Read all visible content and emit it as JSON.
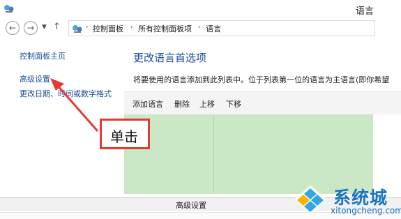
{
  "window": {
    "title": "语言"
  },
  "addressbar": {
    "breadcrumbs": [
      "控制面板",
      "所有控制面板项",
      "语言"
    ]
  },
  "sidebar": {
    "items": [
      {
        "label": "控制面板主页"
      },
      {
        "label": "高级设置"
      },
      {
        "label": "更改日期、时间或数字格式"
      }
    ]
  },
  "main": {
    "title": "更改语言首选项",
    "description": "将要使用的语言添加到此列表中。位于列表第一位的语言为主语言(即你希望",
    "toolbar": {
      "add": "添加语言",
      "delete": "删除",
      "up": "上移",
      "down": "下移"
    }
  },
  "annotation": {
    "callout": "单击",
    "color": "#e53935"
  },
  "bottom": {
    "title": "高级设置"
  },
  "watermark": {
    "brand": "系统城",
    "domain": "xitongcheng.com"
  },
  "colors": {
    "link": "#1a4a9c",
    "heading": "#1e4e97",
    "list_bg": "#cbe8c6",
    "watermark": "#1a73c4"
  }
}
